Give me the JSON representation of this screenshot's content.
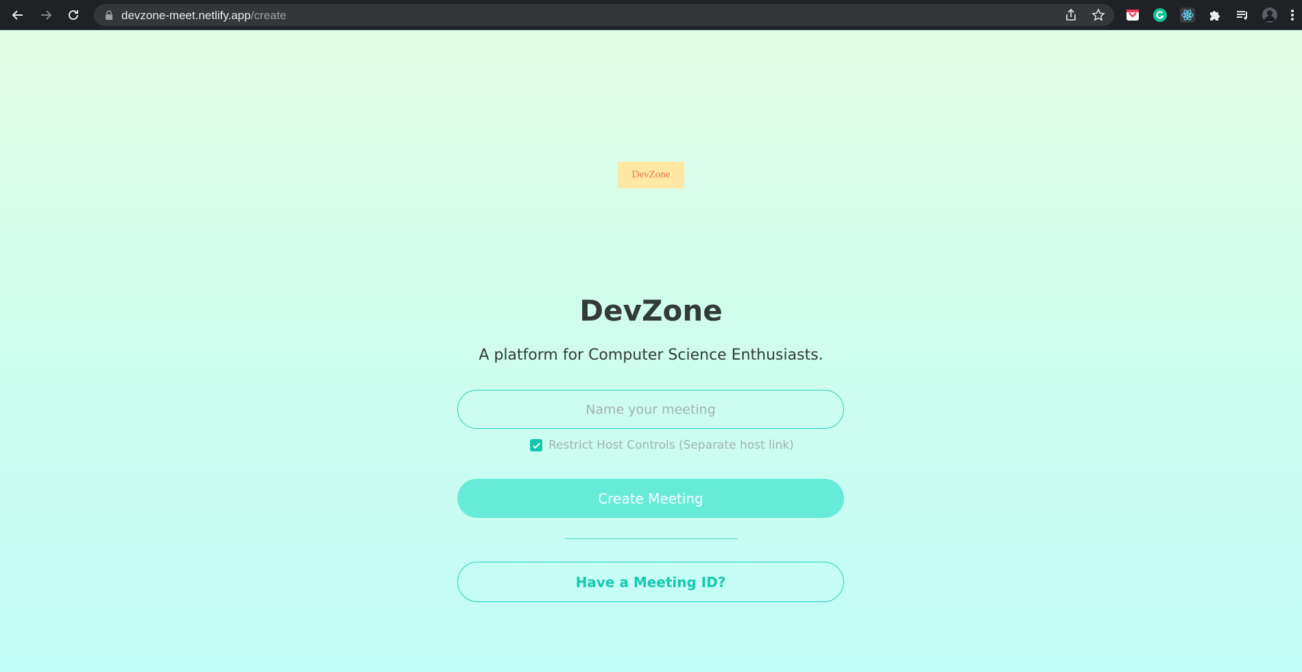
{
  "browser": {
    "url_host": "devzone-meet.netlify.app",
    "url_path": "/create",
    "icons": [
      "back-icon",
      "forward-icon",
      "reload-icon",
      "lock-icon",
      "share-icon",
      "bookmark-star-icon",
      "pocket-extension-icon",
      "grammarly-extension-icon",
      "react-devtools-extension-icon",
      "extensions-puzzle-icon",
      "media-queue-icon",
      "profile-avatar",
      "menu-dots-icon"
    ]
  },
  "page": {
    "logo_text": "DevZone",
    "title": "DevZone",
    "subtitle": "A platform for Computer Science Enthusiasts.",
    "meeting_name_placeholder": "Name your meeting",
    "meeting_name_value": "",
    "restrict_checked": true,
    "restrict_label": "Restrict Host Controls (Separate host link)",
    "create_button": "Create Meeting",
    "meeting_id_button": "Have a Meeting ID?"
  },
  "colors": {
    "accent": "#21d1b9",
    "button_fill": "#67ebd9",
    "logo_bg": "#fee8a3",
    "logo_text": "#e8774a"
  }
}
